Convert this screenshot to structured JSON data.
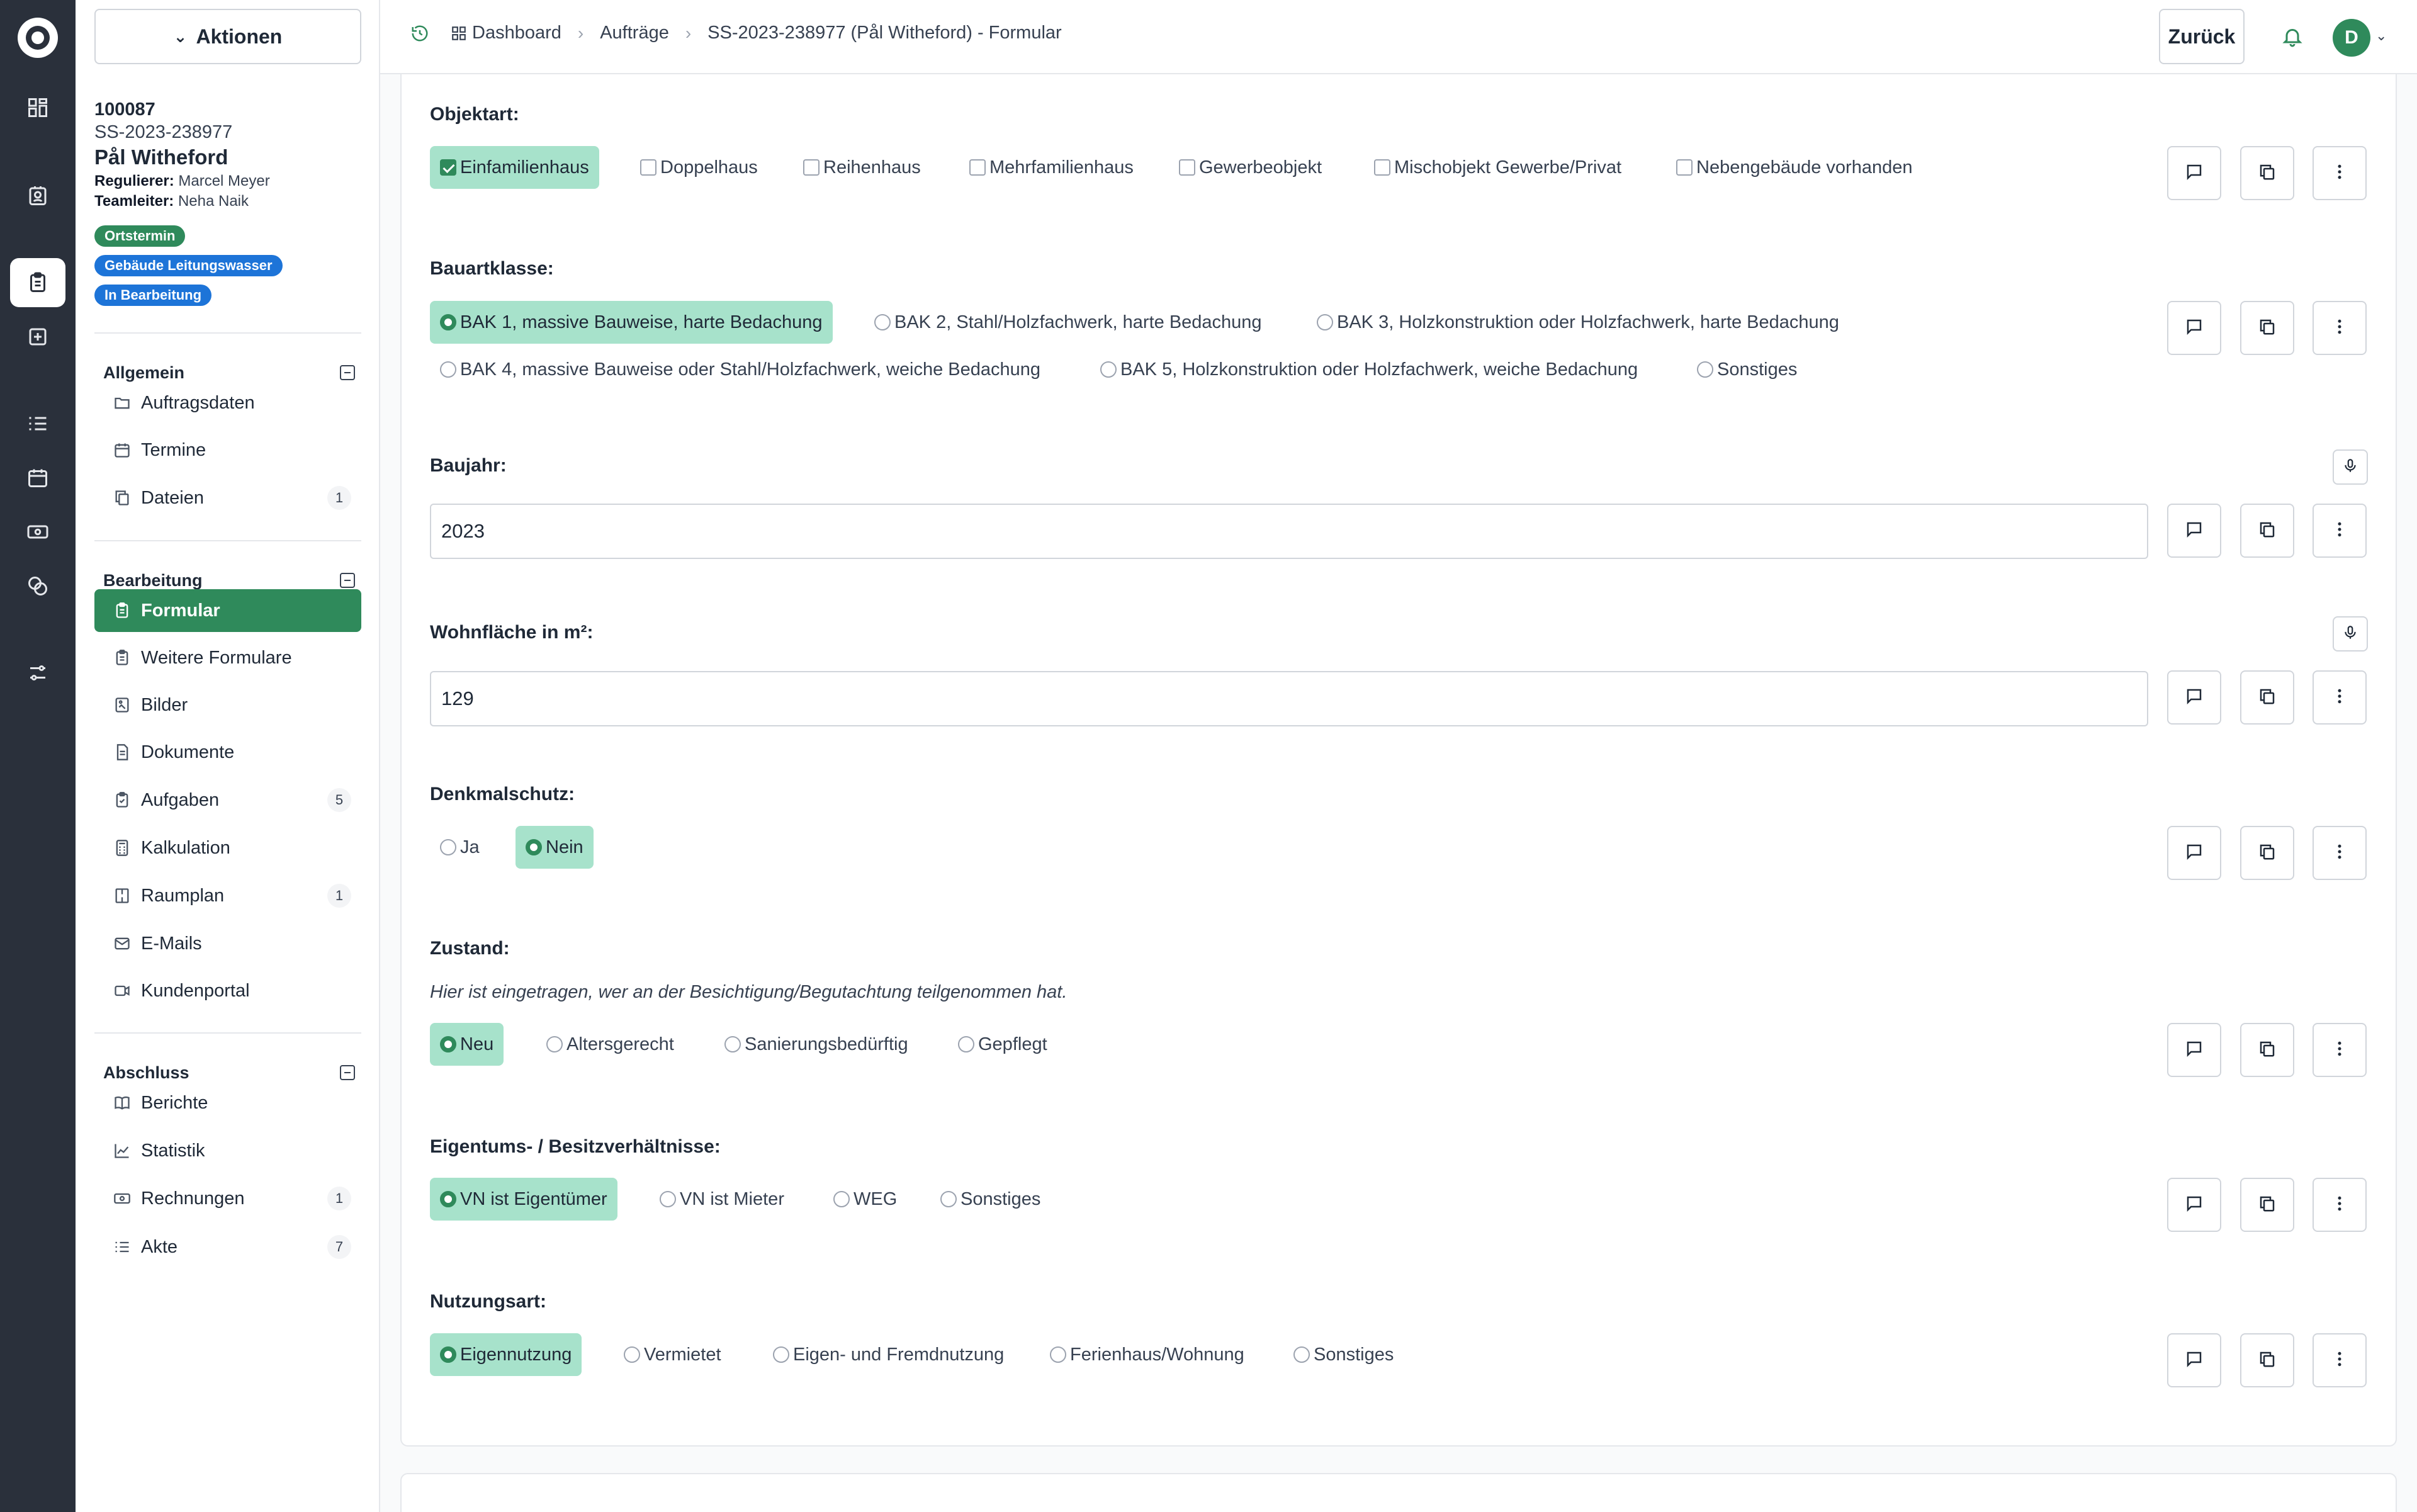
{
  "sidebar": {
    "actions_label": "Aktionen",
    "case": {
      "id": "100087",
      "number": "SS-2023-238977",
      "name": "Pål Witheford",
      "regulierer_label": "Regulierer:",
      "regulierer": "Marcel Meyer",
      "teamleiter_label": "Teamleiter:",
      "teamleiter": "Neha Naik"
    },
    "badges": [
      "Ortstermin",
      "Gebäude Leitungswasser",
      "In Bearbeitung"
    ],
    "sections": [
      {
        "title": "Allgemein",
        "items": [
          {
            "label": "Auftragsdaten",
            "icon": "folder-icon",
            "count": ""
          },
          {
            "label": "Termine",
            "icon": "calendar-icon",
            "count": ""
          },
          {
            "label": "Dateien",
            "icon": "files-icon",
            "count": "1"
          }
        ]
      },
      {
        "title": "Bearbeitung",
        "items": [
          {
            "label": "Formular",
            "icon": "clipboard-icon",
            "count": ""
          },
          {
            "label": "Weitere Formulare",
            "icon": "clipboard-icon",
            "count": ""
          },
          {
            "label": "Bilder",
            "icon": "image-icon",
            "count": ""
          },
          {
            "label": "Dokumente",
            "icon": "document-icon",
            "count": ""
          },
          {
            "label": "Aufgaben",
            "icon": "clipboard-check-icon",
            "count": "5"
          },
          {
            "label": "Kalkulation",
            "icon": "calculator-icon",
            "count": ""
          },
          {
            "label": "Raumplan",
            "icon": "floorplan-icon",
            "count": "1"
          },
          {
            "label": "E-Mails",
            "icon": "mail-icon",
            "count": ""
          },
          {
            "label": "Kundenportal",
            "icon": "video-icon",
            "count": ""
          }
        ]
      },
      {
        "title": "Abschluss",
        "items": [
          {
            "label": "Berichte",
            "icon": "book-icon",
            "count": ""
          },
          {
            "label": "Statistik",
            "icon": "chart-icon",
            "count": ""
          },
          {
            "label": "Rechnungen",
            "icon": "money-icon",
            "count": "1"
          },
          {
            "label": "Akte",
            "icon": "list-icon",
            "count": "7"
          }
        ]
      }
    ]
  },
  "header": {
    "breadcrumbs": [
      "Dashboard",
      "Aufträge",
      "SS-2023-238977 (Pål Witheford) - Formular"
    ],
    "back_label": "Zurück",
    "avatar_initial": "D"
  },
  "form": {
    "objektart": {
      "label": "Objektart:",
      "options": [
        "Einfamilienhaus",
        "Doppelhaus",
        "Reihenhaus",
        "Mehrfamilienhaus",
        "Gewerbeobjekt",
        "Mischobjekt Gewerbe/Privat",
        "Nebengebäude vorhanden"
      ],
      "selected": "Einfamilienhaus"
    },
    "bauartklasse": {
      "label": "Bauartklasse:",
      "options": [
        "BAK 1, massive Bauweise, harte Bedachung",
        "BAK 2, Stahl/Holzfachwerk, harte Bedachung",
        "BAK 3, Holzkonstruktion oder Holzfachwerk, harte Bedachung",
        "BAK 4, massive Bauweise oder Stahl/Holzfachwerk, weiche Bedachung",
        "BAK 5, Holzkonstruktion oder Holzfachwerk, weiche Bedachung",
        "Sonstiges"
      ],
      "selected": "BAK 1, massive Bauweise, harte Bedachung"
    },
    "baujahr": {
      "label": "Baujahr:",
      "value": "2023"
    },
    "wohnflaeche": {
      "label": "Wohnfläche in m²:",
      "value": "129"
    },
    "denkmalschutz": {
      "label": "Denkmalschutz:",
      "options": [
        "Ja",
        "Nein"
      ],
      "selected": "Nein"
    },
    "zustand": {
      "label": "Zustand:",
      "help": "Hier ist eingetragen, wer an der Besichtigung/Begutachtung teilgenommen hat.",
      "options": [
        "Neu",
        "Altersgerecht",
        "Sanierungsbedürftig",
        "Gepflegt"
      ],
      "selected": "Neu"
    },
    "eigentum": {
      "label": "Eigentums- / Besitzverhältnisse:",
      "options": [
        "VN ist Eigentümer",
        "VN ist Mieter",
        "WEG",
        "Sonstiges"
      ],
      "selected": "VN ist Eigentümer"
    },
    "nutzungsart": {
      "label": "Nutzungsart:",
      "options": [
        "Eigennutzung",
        "Vermietet",
        "Eigen- und Fremdnutzung",
        "Ferienhaus/Wohnung",
        "Sonstiges"
      ],
      "selected": "Eigennutzung"
    }
  },
  "colors": {
    "accent": "#2f8a5b",
    "selected_bg": "#a7e2cb",
    "rail_bg": "#2a303b",
    "badge_blue": "#1d74d8"
  }
}
